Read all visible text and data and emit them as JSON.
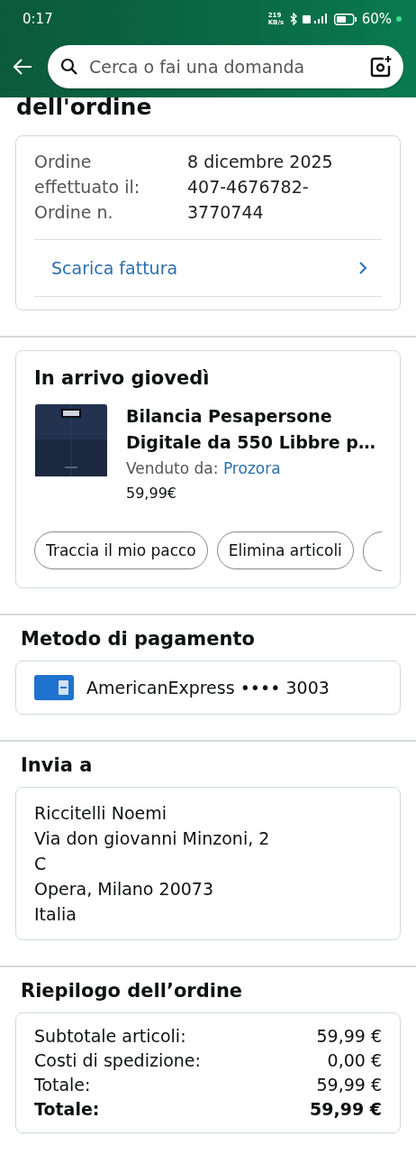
{
  "status_bar": {
    "time": "0:17",
    "speed": "219 KB/s",
    "battery": "60%"
  },
  "search": {
    "placeholder": "Cerca o fai una domanda"
  },
  "title": "dell'ordine",
  "order_info": {
    "labels": [
      "Ordine effettuato il:",
      "Ordine n."
    ],
    "values": [
      "8 dicembre 2025",
      "407-4676782-3770744"
    ],
    "invoice_link": "Scarica fattura"
  },
  "shipment": {
    "heading": "In arrivo giovedì",
    "product": {
      "kind": "picture",
      "name": "Bilancia Pesapersone Digitale da 550 Libbre p…",
      "sold_by_label": "Venduto da:",
      "seller": "Prozora",
      "price": "59,99€"
    },
    "actions": [
      "Traccia il mio pacco",
      "Elimina articoli"
    ]
  },
  "payment": {
    "heading": "Metodo di pagamento",
    "method": "AmericanExpress •••• 3003"
  },
  "shipping": {
    "heading": "Invia a",
    "address": [
      "Riccitelli Noemi",
      "Via don giovanni Minzoni, 2",
      "C",
      "Opera, Milano 20073",
      "Italia"
    ]
  },
  "summary": {
    "heading": "Riepilogo dell’ordine",
    "rows": [
      {
        "label": "Subtotale articoli:",
        "value": "59,99 €",
        "bold": false
      },
      {
        "label": "Costi di spedizione:",
        "value": "0,00 €",
        "bold": false
      },
      {
        "label": "Totale:",
        "value": "59,99 €",
        "bold": false
      },
      {
        "label": "Totale:",
        "value": "59,99 €",
        "bold": true
      }
    ]
  }
}
